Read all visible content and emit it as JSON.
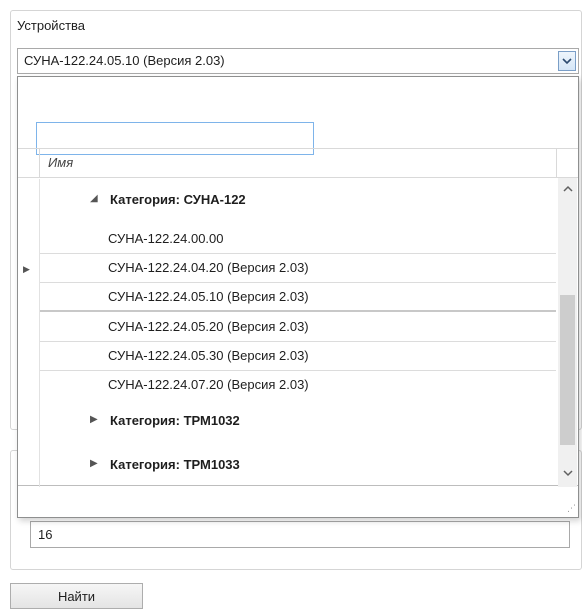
{
  "form": {
    "devices_label": "Устройства",
    "selected_device": "СУНА-122.24.05.10 (Версия 2.03)",
    "value_field": "16",
    "find_button": "Найти"
  },
  "dropdown": {
    "search_value": "",
    "column_name": "Имя",
    "groups": [
      {
        "label": "Категория: СУНА-122",
        "expanded": true,
        "items": [
          "СУНА-122.24.00.00",
          "СУНА-122.24.04.20 (Версия 2.03)",
          "СУНА-122.24.05.10 (Версия 2.03)",
          "СУНА-122.24.05.20 (Версия 2.03)",
          "СУНА-122.24.05.30 (Версия 2.03)",
          "СУНА-122.24.07.20 (Версия 2.03)"
        ],
        "current_item": "СУНА-122.24.05.10 (Версия 2.03)"
      },
      {
        "label": "Категория: ТРМ1032",
        "expanded": false
      },
      {
        "label": "Категория: ТРМ1033",
        "expanded": false
      }
    ]
  },
  "icons": {
    "combo_dropdown": "chevron-down-icon",
    "expanded_group": "triangle-expanded-icon",
    "collapsed_group": "triangle-collapsed-icon",
    "current_row": "row-pointer-icon",
    "scroll_up": "chevron-up-icon",
    "scroll_down": "chevron-down-icon",
    "resize": "resize-grip-icon"
  },
  "colors": {
    "search_border": "#7eb4ea",
    "combo_button": "#d5e6f7",
    "scroll_thumb": "#cdcdcd"
  }
}
